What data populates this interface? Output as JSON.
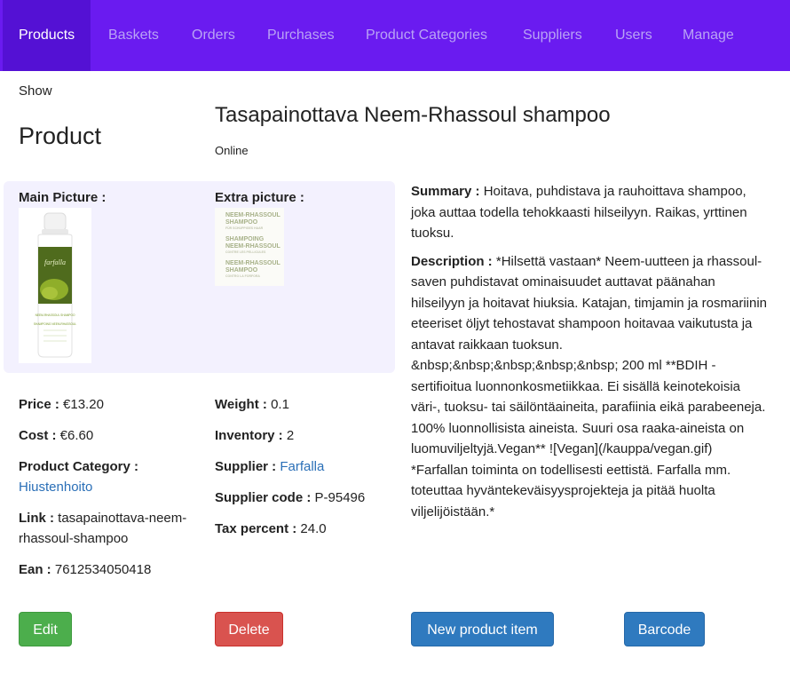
{
  "nav": {
    "items": [
      {
        "label": "Products",
        "active": true
      },
      {
        "label": "Baskets"
      },
      {
        "label": "Orders"
      },
      {
        "label": "Purchases"
      },
      {
        "label": "Product Categories"
      },
      {
        "label": "Suppliers"
      },
      {
        "label": "Users"
      },
      {
        "label": "Manage"
      }
    ],
    "bg_color": "#6a1bf0",
    "active_bg_color": "#5411d4"
  },
  "breadcrumb": "Show",
  "page_heading": "Product",
  "product": {
    "name": "Tasapainottava Neem-Rhassoul shampoo",
    "status": "Online",
    "main_picture_label": "Main Picture :",
    "extra_picture_label": "Extra picture :",
    "main_picture_bottle": {
      "brand": "farfalla",
      "label_lines": [
        "NEEM-RHASSOUL SHAMPOO",
        "SHAMPOING NEEM-RHASSOUL"
      ]
    },
    "extra_picture_lines": [
      "NEEM-RHASSOUL",
      "SHAMPOO",
      "FÜR SCHUPPIGES HAAR",
      "SHAMPOING",
      "NEEM-RHASSOUL",
      "CONTRE LES PELLICULES",
      "NEEM-RHASSOUL",
      "SHAMPOO",
      "CONTRO LA FORFORA"
    ],
    "fields_left": [
      {
        "label": "Price :",
        "value": "€13.20"
      },
      {
        "label": "Cost :",
        "value": "€6.60"
      },
      {
        "label": "Product Category :",
        "value": "Hiustenhoito",
        "is_link": true
      },
      {
        "label": "Link :",
        "value": "tasapainottava-neem-rhassoul-shampoo"
      },
      {
        "label": "Ean :",
        "value": "7612534050418"
      }
    ],
    "fields_right": [
      {
        "label": "Weight :",
        "value": "0.1"
      },
      {
        "label": "Inventory :",
        "value": "2"
      },
      {
        "label": "Supplier :",
        "value": "Farfalla",
        "is_link": true
      },
      {
        "label": "Supplier code :",
        "value": "P-95496"
      },
      {
        "label": "Tax percent :",
        "value": "24.0"
      }
    ],
    "summary_label": "Summary :",
    "summary": "Hoitava, puhdistava ja rauhoittava shampoo, joka auttaa todella tehokkaasti hilseilyyn. Raikas, yrttinen tuoksu.",
    "description_label": "Description :",
    "description": "*Hilsettä vastaan* Neem-uutteen ja rhassoul-saven puhdistavat ominaisuudet auttavat päänahan hilseilyyn ja hoitavat hiuksia. Katajan, timjamin ja rosmariinin eteeriset öljyt tehostavat shampoon hoitavaa vaikutusta ja antavat raikkaan tuoksun. &nbsp;&nbsp;&nbsp;&nbsp;&nbsp; 200 ml **BDIH -sertifioitua luonnonkosmetiikkaa. Ei sisällä keinotekoisia väri-, tuoksu- tai säilöntäaineita, parafiinia eikä parabeeneja. 100% luonnollisista aineista. Suuri osa raaka-aineista on luomuviljeltyjä.Vegan** ![Vegan](/kauppa/vegan.gif) *Farfallan toiminta on todellisesti eettistä. Farfalla mm. toteuttaa hyväntekeväisyysprojekteja ja pitää huolta viljelijöistään.*"
  },
  "actions": {
    "edit": "Edit",
    "delete": "Delete",
    "new_item": "New product item",
    "barcode": "Barcode"
  },
  "colors": {
    "edit": "#4cae4c",
    "delete": "#d9534f",
    "primary": "#2f7abf",
    "link": "#2a6fb7",
    "picture_panel": "#f3f1fe"
  }
}
